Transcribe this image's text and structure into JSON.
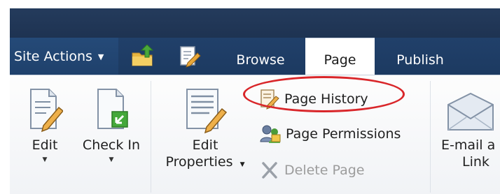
{
  "nav": {
    "site_actions_label": "Site Actions",
    "tabs": [
      {
        "label": "Browse"
      },
      {
        "label": "Page",
        "selected": true
      },
      {
        "label": "Publish"
      }
    ]
  },
  "ribbon": {
    "edit_label": "Edit",
    "check_in_label": "Check In",
    "edit_properties_label_line1": "Edit",
    "edit_properties_label_line2": "Properties",
    "page_history_label": "Page History",
    "page_permissions_label": "Page Permissions",
    "delete_page_label": "Delete Page",
    "email_link_line1": "E-mail a",
    "email_link_line2": "Link"
  },
  "colors": {
    "title_band": "#243b5c",
    "tab_row": "#1f3d66",
    "highlight_circle": "#d9262a"
  }
}
